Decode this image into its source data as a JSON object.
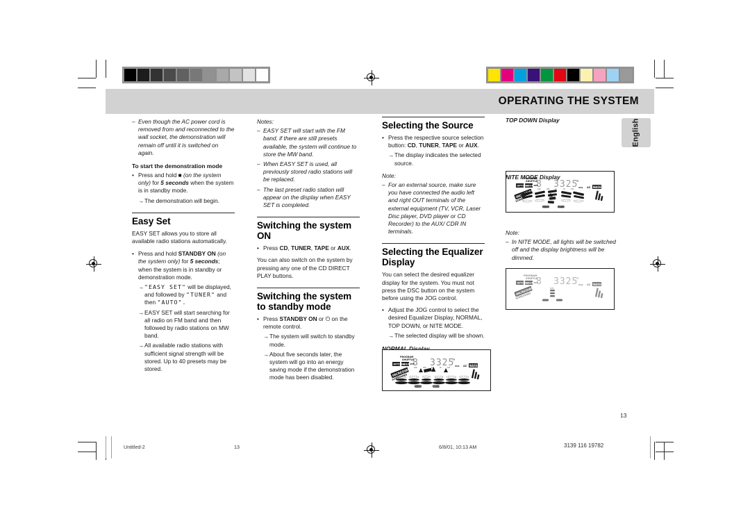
{
  "header": {
    "title": "OPERATING THE SYSTEM",
    "language_tab": "English"
  },
  "page_number": "13",
  "footer": {
    "filename": "Untitled-2",
    "page": "13",
    "timestamp": "6/8/01, 10:13 AM",
    "doc_code": "3139 116 19782"
  },
  "strips": {
    "gray": [
      "#000000",
      "#1c1c1c",
      "#333333",
      "#4b4b4b",
      "#616161",
      "#787878",
      "#919191",
      "#a9a9a9",
      "#c3c3c3",
      "#e2e2e2",
      "#ffffff"
    ],
    "color": [
      "#ffe400",
      "#e5007e",
      "#00a0e3",
      "#3a1178",
      "#009640",
      "#e30613",
      "#000000",
      "#fbf2b0",
      "#f5a3c0",
      "#9ed2f2",
      "#9a9a9a"
    ]
  },
  "column1": {
    "note_top": "Even though the AC power cord is removed from and reconnected to the wall socket, the demonstration will remain off until it is switched on again.",
    "demo_heading": "To start the demonstration mode",
    "demo_bullet_a": "Press and hold",
    "demo_bullet_b": "(on the system only)",
    "demo_bullet_c": "for",
    "demo_bullet_d": "5 seconds",
    "demo_bullet_e": "when the system is in standby mode.",
    "demo_arrow": "The demonstration will begin.",
    "easyset_heading": "Easy Set",
    "easyset_intro": "EASY SET allows you to store all available radio stations automatically.",
    "easyset_bullet_a": "Press and hold",
    "easyset_bullet_b": "STANDBY ON",
    "easyset_bullet_c": "(on the system only)",
    "easyset_bullet_d": "for",
    "easyset_bullet_e": "5 seconds",
    "easyset_bullet_f": "; when the system is in standby or demonstration mode.",
    "easyset_arrow1_a": "\"EASY SET\"",
    "easyset_arrow1_b": "will be displayed, and followed by",
    "easyset_arrow1_c": "\"TUNER\"",
    "easyset_arrow1_d": "and then",
    "easyset_arrow1_e": "\"AUTO\".",
    "easyset_arrow2": "EASY SET will start searching for all radio on FM band and then followed by radio stations on MW band.",
    "easyset_arrow3": "All available radio stations with sufficient signal strength will be stored. Up to 40 presets may be stored."
  },
  "column2": {
    "notes_label": "Notes:",
    "note1": "EASY SET will start with the FM band, if there are still presets available, the system will continue to store the MW band.",
    "note2": "When EASY SET is used, all previously stored radio stations will be replaced.",
    "note3": "The last preset radio station will appear on the display when EASY SET is completed.",
    "on_heading": "Switching the system ON",
    "on_bullet_a": "Press",
    "on_bullet_b": "CD",
    "on_bullet_c": ",",
    "on_bullet_d": "TUNER",
    "on_bullet_e": ",",
    "on_bullet_f": "TAPE",
    "on_bullet_g": "or",
    "on_bullet_h": "AUX",
    "on_bullet_i": ".",
    "on_body": "You can also switch on the system by pressing any one of the CD DIRECT PLAY buttons.",
    "standby_heading": "Switching the system to standby mode",
    "standby_bullet_a": "Press",
    "standby_bullet_b": "STANDBY ON",
    "standby_bullet_c": "or",
    "standby_bullet_d": "on the remote control.",
    "standby_arrow1": "The system will switch to standby mode.",
    "standby_arrow2": "About five seconds later, the system will go into an energy saving mode if the demonstration mode has been disabled."
  },
  "column3": {
    "source_heading": "Selecting the Source",
    "source_bullet_a": "Press the respective source selection button:",
    "source_bullet_b": "CD",
    "source_bullet_c": ",",
    "source_bullet_d": "TUNER",
    "source_bullet_e": ",",
    "source_bullet_f": "TAPE",
    "source_bullet_g": "or",
    "source_bullet_h": "AUX",
    "source_bullet_i": ".",
    "source_arrow": "The display indicates the selected source.",
    "note_label": "Note:",
    "note_text": "For an external source, make sure you have connected the audio left and right OUT terminals of the external equipment (TV, VCR, Laser Disc player, DVD player or CD Recorder) to the AUX/ CDR IN terminals.",
    "eq_heading": "Selecting the Equalizer Display",
    "eq_body": "You can select the desired equalizer display for the system. You must not press the DSC button on the system before using the JOG control.",
    "eq_bullet": "Adjust the JOG control to select the desired Equalizer Display, NORMAL, TOP DOWN, or NITE MODE.",
    "eq_arrow": "The selected display will be shown.",
    "normal_label": "NORMAL Display"
  },
  "column4": {
    "topdown_label": "TOP DOWN Display",
    "nitemode_label": "NITE MODE Display",
    "note_label": "Note:",
    "note_text": "In NITE MODE, all lights will be switched off and the display brightness will be dimmed."
  },
  "lcd": {
    "big_digit": "8",
    "track_digits": "3325",
    "top_labels": [
      "PROGRAM",
      "SHUFFLE"
    ],
    "left_labels": [
      "OPTIMAL",
      "SOUND",
      "REP"
    ],
    "right_labels": [
      "VOL",
      "AZ",
      "BASS"
    ],
    "brand": "INCREDIBLE SURROUND"
  }
}
